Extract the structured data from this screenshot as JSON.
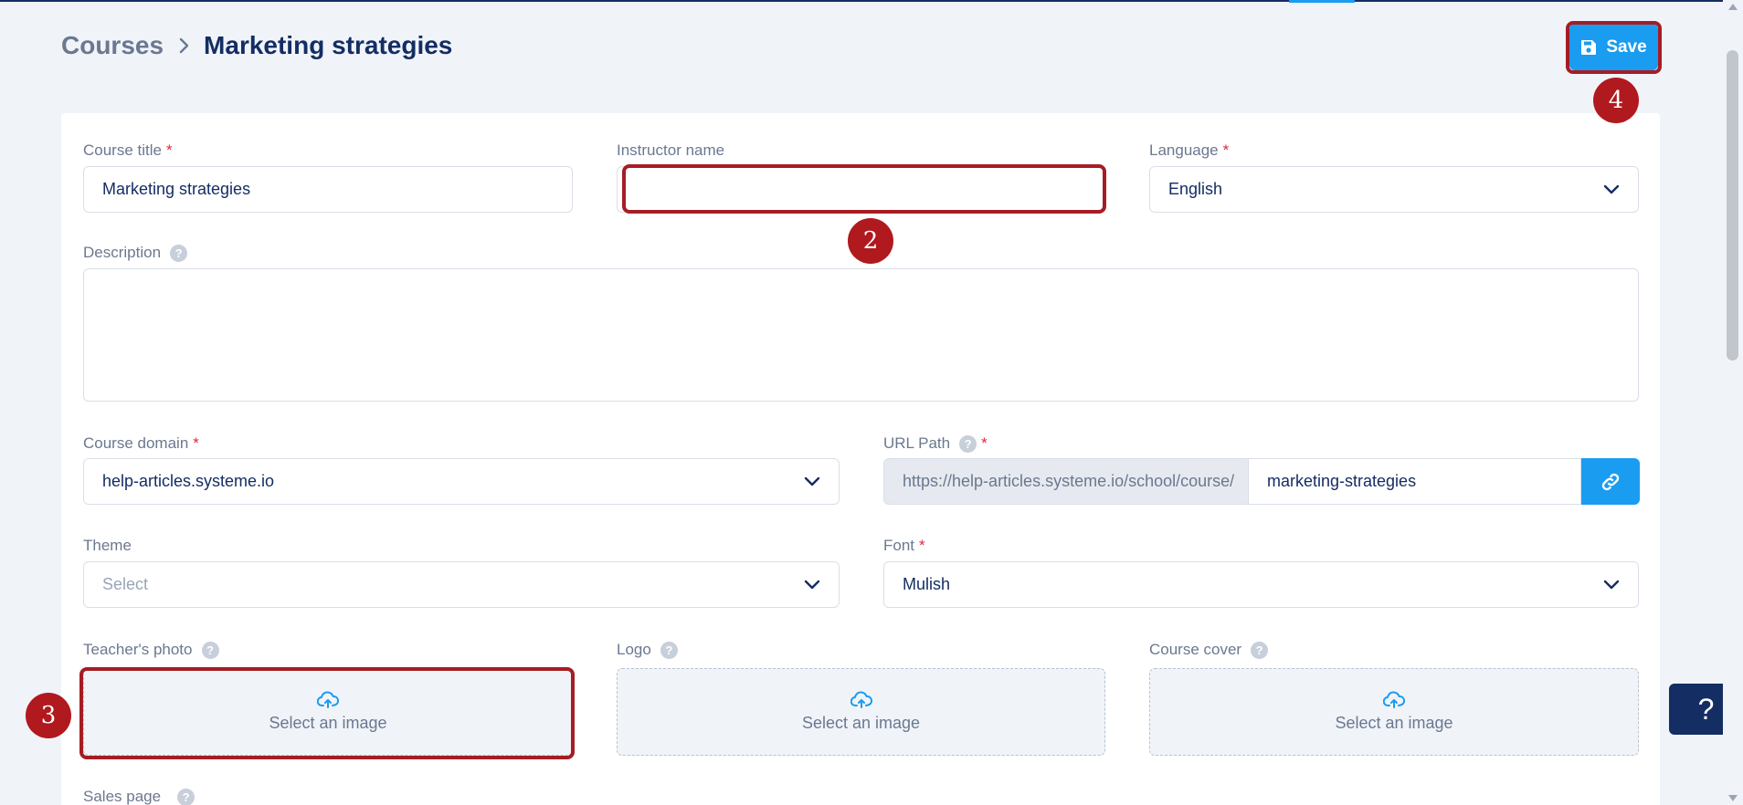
{
  "breadcrumb": {
    "parent": "Courses",
    "current": "Marketing strategies"
  },
  "toolbar": {
    "save_label": "Save"
  },
  "form": {
    "course_title": {
      "label": "Course title",
      "required": "*",
      "value": "Marketing strategies"
    },
    "instructor_name": {
      "label": "Instructor name",
      "value": ""
    },
    "language": {
      "label": "Language",
      "required": "*",
      "value": "English"
    },
    "description": {
      "label": "Description",
      "help": "?"
    },
    "course_domain": {
      "label": "Course domain",
      "required": "*",
      "value": "help-articles.systeme.io"
    },
    "url_path": {
      "label": "URL Path",
      "help": "?",
      "required": "*",
      "prefix": "https://help-articles.systeme.io/school/course/",
      "slug": "marketing-strategies"
    },
    "theme": {
      "label": "Theme",
      "placeholder": "Select"
    },
    "font": {
      "label": "Font",
      "required": "*",
      "value": "Mulish"
    },
    "teacher_photo": {
      "label": "Teacher's photo",
      "help": "?",
      "upload_text": "Select an image"
    },
    "logo": {
      "label": "Logo",
      "help": "?",
      "upload_text": "Select an image"
    },
    "course_cover": {
      "label": "Course cover",
      "help": "?",
      "upload_text": "Select an image"
    },
    "sales_page": {
      "label": "Sales page",
      "help": "?"
    }
  },
  "annotations": {
    "marker_2": "2",
    "marker_3": "3",
    "marker_4": "4"
  },
  "help_widget": {
    "label": "?"
  },
  "colors": {
    "accent": "#1a9cf0",
    "navy": "#142d63",
    "annotation": "#a51d24"
  },
  "icons": {
    "save": "floppy-disk-icon",
    "link": "link-icon",
    "upload": "cloud-upload-icon",
    "chevron": "chevron-down-icon",
    "breadcrumb_sep": "chevron-right-icon"
  }
}
